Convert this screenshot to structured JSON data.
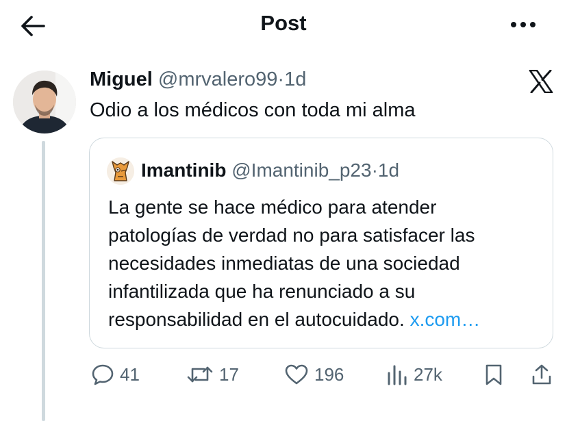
{
  "header": {
    "title": "Post"
  },
  "post": {
    "author_name": "Miguel",
    "author_handle": "@mrvalero99",
    "separator": "·",
    "time": "1d",
    "text": "Odio a los médicos con toda mi alma"
  },
  "quote": {
    "author_name": "Imantinib",
    "author_handle": "@Imantinib_p23",
    "separator": "·",
    "time": "1d",
    "text_lines": [
      "La gente se hace médico para atender",
      "patologías de verdad no para satisfacer las",
      "necesidades inmediatas de una sociedad",
      "infantilizada que ha renunciado a su",
      "responsabilidad en el autocuidado."
    ],
    "link_text": "x.com…"
  },
  "actions": {
    "replies": "41",
    "reposts": "17",
    "likes": "196",
    "views": "27k"
  },
  "colors": {
    "text": "#0f1419",
    "secondary": "#536471",
    "link": "#1d9bf0",
    "border": "#cfd9de"
  },
  "icons": [
    "back-arrow-icon",
    "more-icon",
    "x-logo-icon",
    "reply-icon",
    "repost-icon",
    "like-icon",
    "views-icon",
    "bookmark-icon",
    "share-icon"
  ]
}
